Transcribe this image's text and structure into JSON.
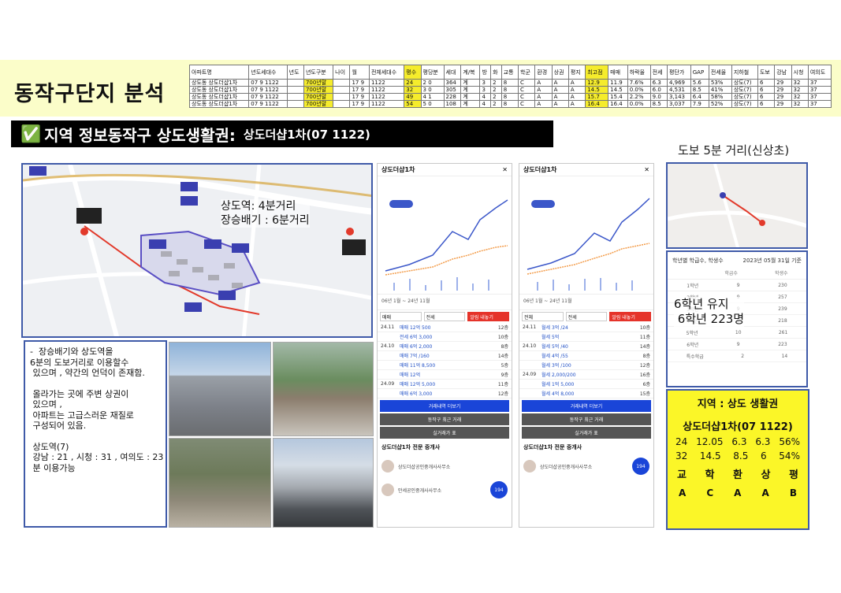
{
  "page": {
    "title": "동작구단지 분석"
  },
  "table": {
    "headers": [
      "아파트명",
      "년도세대수",
      "년도",
      "년도구분",
      "나이",
      "월",
      "전체세대수",
      "평수",
      "평당분",
      "세대",
      "계/복",
      "방",
      "화",
      "교통",
      "학군",
      "환경",
      "상권",
      "평지",
      "최고점",
      "매매",
      "하락율",
      "전세",
      "평단가",
      "GAP",
      "전세율",
      "지하철",
      "도보",
      "강남",
      "시청",
      "여의도"
    ],
    "rows": [
      [
        "상도동 상도더샵1차",
        "07 9 1122",
        "",
        "700년말",
        "",
        "17 9",
        "1122",
        "24",
        "2 0",
        "364",
        "계",
        "3",
        "2",
        "8",
        "C",
        "A",
        "A",
        "A",
        "12.9",
        "11.9",
        "7.6%",
        "6.3",
        "4,969",
        "5.6",
        "53%",
        "상도(7)",
        "6",
        "29",
        "32",
        "37"
      ],
      [
        "상도동 상도더샵1차",
        "07 9 1122",
        "",
        "700년말",
        "",
        "17 9",
        "1122",
        "32",
        "3 0",
        "305",
        "계",
        "3",
        "2",
        "8",
        "C",
        "A",
        "A",
        "A",
        "14.5",
        "14.5",
        "0.0%",
        "6.0",
        "4,531",
        "8.5",
        "41%",
        "상도(7)",
        "6",
        "29",
        "32",
        "37"
      ],
      [
        "상도동 상도더샵1차",
        "07 9 1122",
        "",
        "700년말",
        "",
        "17 9",
        "1122",
        "49",
        "4 1",
        "228",
        "계",
        "4",
        "2",
        "8",
        "C",
        "A",
        "A",
        "A",
        "15.7",
        "15.4",
        "2.2%",
        "9.0",
        "3,143",
        "6.4",
        "58%",
        "상도(7)",
        "6",
        "29",
        "32",
        "37"
      ],
      [
        "상도동 상도더샵1차",
        "07 9 1122",
        "",
        "700년말",
        "",
        "17 9",
        "1122",
        "54",
        "5 0",
        "108",
        "계",
        "4",
        "2",
        "8",
        "C",
        "A",
        "A",
        "A",
        "16.4",
        "16.4",
        "0.0%",
        "8.5",
        "3,037",
        "7.9",
        "52%",
        "상도(7)",
        "6",
        "29",
        "32",
        "37"
      ]
    ]
  },
  "region": {
    "check": "✅",
    "title": "지역 정보동작구 상도생활권:",
    "sub": "상도더샵1차(07 1122)"
  },
  "walk_label": "도보 5분 거리(신상초)",
  "map": {
    "annot_line1": "상도역: 4분거리",
    "annot_line2": "장승배기 : 6분거리"
  },
  "description": {
    "line1": "-  장승배기와 상도역을",
    "line2": "6분의 도보거리로 이용할수",
    "line3": " 있으며 , 약간의 언덕이 존재함.",
    "line4": " 올라가는 곳에 주변 상권이",
    "line5": " 있으며 ,",
    "line6": " 아파트는 고급스러운 재질로",
    "line7": " 구성되어 있음.",
    "line8": " 상도역(7)",
    "line9": " 강남 : 21 , 시청 : 31 , 여의도 : 23",
    "line10": " 분 이용가능"
  },
  "app1": {
    "title": "상도더샵1차",
    "range": "06년 1월 ~ 24년 11월",
    "filter1": "매매",
    "filter2": "전세",
    "filter3": "월세",
    "filter_btn": "알림 내놓기",
    "trades": [
      {
        "date": "24.11",
        "price": "매매 12억 500",
        "floor": "12층"
      },
      {
        "date": "",
        "price": "전세 6억 3,000",
        "floor": "10층"
      },
      {
        "date": "24.10",
        "price": "매매 6억 2,000",
        "floor": "8층"
      },
      {
        "date": "",
        "price": "매매 7억 /160",
        "floor": "14층"
      },
      {
        "date": "",
        "price": "매매 11억 8,500",
        "floor": "5층"
      },
      {
        "date": "",
        "price": "매매 12억",
        "floor": "9층"
      },
      {
        "date": "24.09",
        "price": "매매 12억 5,000",
        "floor": "11층"
      },
      {
        "date": "",
        "price": "매매 6억 3,000",
        "floor": "12층"
      }
    ],
    "btn1": "거래내역 더보기",
    "btn2": "동작구 최근 거래",
    "btn3": "실거래가 표",
    "agent_title": "상도더샵1차 전문 중개사",
    "agent1": "상도더샵공인중개사사무소",
    "agent2": "만세공인중개사사무소",
    "badge": "194"
  },
  "app2": {
    "title": "상도더샵1차",
    "range": "06년 1월 ~ 24년 11월",
    "filter1": "전체",
    "filter2": "전세",
    "filter_btn": "알림 내놓기",
    "trades": [
      {
        "date": "24.11",
        "price": "월세 3억 /24",
        "floor": "10층"
      },
      {
        "date": "",
        "price": "월세 5억",
        "floor": "11층"
      },
      {
        "date": "24.10",
        "price": "월세 5억 /40",
        "floor": "14층"
      },
      {
        "date": "",
        "price": "월세 4억 /55",
        "floor": "8층"
      },
      {
        "date": "",
        "price": "월세 3억 /100",
        "floor": "12층"
      },
      {
        "date": "24.09",
        "price": "월세 2,000/200",
        "floor": "16층"
      },
      {
        "date": "",
        "price": "월세 1억 5,000",
        "floor": "6층"
      },
      {
        "date": "",
        "price": "월세 4억 8,000",
        "floor": "15층"
      }
    ],
    "btn1": "거래내역 더보기",
    "btn2": "동작구 최근 거래",
    "btn3": "실거래가 표",
    "agent_title": "상도더샵1차 전문 중개사",
    "agent1": "상도더샵공인중개사사무소",
    "badge": "194"
  },
  "school": {
    "title": "학년별 학급수, 학생수",
    "date": "2023년 05월 31일 기준",
    "col1": "학급수",
    "col2": "학생수",
    "rows": [
      {
        "grade": "1학년",
        "classes": "9",
        "students": "230"
      },
      {
        "grade": "2학년",
        "classes": "9",
        "students": "257"
      },
      {
        "grade": "3학년",
        "classes": "9",
        "students": "239"
      },
      {
        "grade": "4학년",
        "classes": "9",
        "students": "218"
      },
      {
        "grade": "5학년",
        "classes": "10",
        "students": "261"
      },
      {
        "grade": "6학년",
        "classes": "9",
        "students": "223"
      },
      {
        "grade": "특수학급",
        "classes": "2",
        "students": "14"
      }
    ],
    "note_line1": "6학년 유지",
    "note_line2": " 6학년 223명"
  },
  "summary": {
    "area": "지역 : 상도 생활권",
    "name": "상도더샵1차(07 1122)",
    "row1": [
      "24",
      "12.05",
      "6.3",
      "6.3",
      "56%"
    ],
    "row2": [
      "32",
      "14.5",
      "8.5",
      "6",
      "54%"
    ],
    "grid_headers": [
      "교",
      "학",
      "환",
      "상",
      "평"
    ],
    "grid_values": [
      "A",
      "C",
      "A",
      "A",
      "B"
    ]
  },
  "colors": {
    "accent_yellow": "#fbf628",
    "band_yellow": "#fbfdc9",
    "border_blue": "#3f5aa8",
    "trade_blue": "#1f4fc6",
    "alert_red": "#e5332a"
  }
}
